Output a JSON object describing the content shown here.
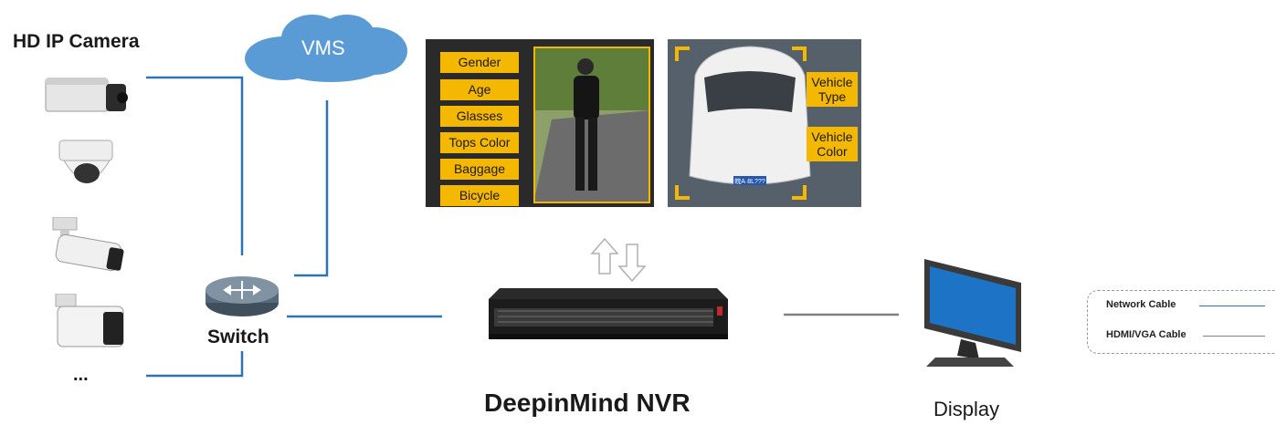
{
  "title_camera": "HD IP Camera",
  "cloud_label": "VMS",
  "switch_label": "Switch",
  "more_label": "...",
  "nvr_label": "DeepinMind NVR",
  "display_label": "Display",
  "human_attributes": [
    "Gender",
    "Age",
    "Glasses",
    "Tops Color",
    "Baggage",
    "Bicycle"
  ],
  "vehicle_attributes": [
    "Vehicle Type",
    "Vehicle Color"
  ],
  "plate_text": "皖A·8L???",
  "legend": {
    "network": "Network Cable",
    "hdmi": "HDMI/VGA Cable"
  },
  "colors": {
    "network_line": "#2e74b5",
    "hdmi_line": "#808080",
    "tag_bg": "#f5b800",
    "cloud": "#5b9bd5"
  }
}
